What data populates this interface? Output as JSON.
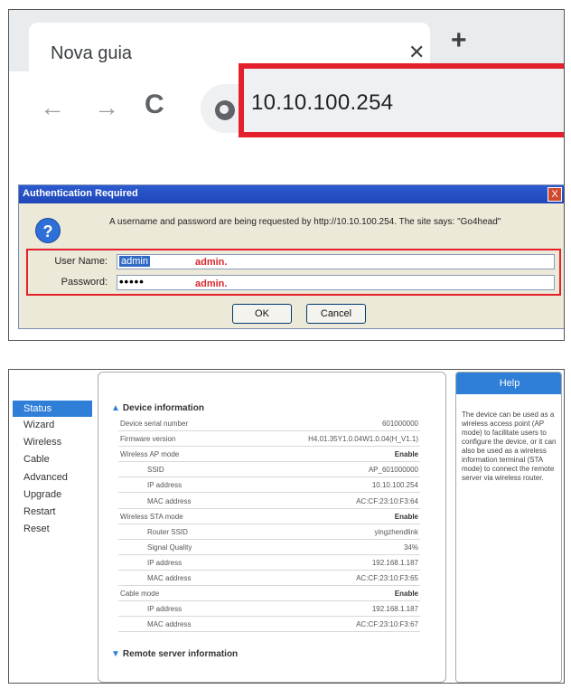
{
  "browser": {
    "tab_title": "Nova guia",
    "close_glyph": "✕",
    "new_tab_glyph": "+",
    "back_glyph": "←",
    "forward_glyph": "→",
    "reload_glyph": "C",
    "url": "10.10.100.254",
    "highlight_color": "#e3202b"
  },
  "auth_dialog": {
    "title": "Authentication Required",
    "close_glyph": "X",
    "help_glyph": "?",
    "message": "A username and password are being requested by http://10.10.100.254. The site says: \"Go4head\"",
    "username_label": "User Name:",
    "username_value": "admin",
    "username_note": "admin.",
    "password_label": "Password:",
    "password_value": "•••••",
    "password_note": "admin.",
    "ok_label": "OK",
    "cancel_label": "Cancel"
  },
  "router": {
    "menu": [
      {
        "label": "Status",
        "active": true
      },
      {
        "label": "Wizard",
        "active": false
      },
      {
        "label": "Wireless",
        "active": false
      },
      {
        "label": "Cable",
        "active": false
      },
      {
        "label": "Advanced",
        "active": false
      },
      {
        "label": "Upgrade",
        "active": false
      },
      {
        "label": "Restart",
        "active": false
      },
      {
        "label": "Reset",
        "active": false
      }
    ],
    "device_info_title": "Device information",
    "rows": [
      {
        "label": "Device serial number",
        "value": "601000000",
        "sub": false,
        "bold": false
      },
      {
        "label": "Firmware version",
        "value": "H4.01.35Y1.0.04W1.0.04(H_V1.1)",
        "sub": false,
        "bold": false
      },
      {
        "label": "Wireless AP mode",
        "value": "Enable",
        "sub": false,
        "bold": true
      },
      {
        "label": "SSID",
        "value": "AP_601000000",
        "sub": true,
        "bold": false
      },
      {
        "label": "IP address",
        "value": "10.10.100.254",
        "sub": true,
        "bold": false
      },
      {
        "label": "MAC address",
        "value": "AC:CF:23:10:F3:64",
        "sub": true,
        "bold": false
      },
      {
        "label": "Wireless STA mode",
        "value": "Enable",
        "sub": false,
        "bold": true
      },
      {
        "label": "Router SSID",
        "value": "yingzhendlink",
        "sub": true,
        "bold": false
      },
      {
        "label": "Signal Quality",
        "value": "34%",
        "sub": true,
        "bold": false
      },
      {
        "label": "IP address",
        "value": "192.168.1.187",
        "sub": true,
        "bold": false
      },
      {
        "label": "MAC address",
        "value": "AC:CF:23:10:F3:65",
        "sub": true,
        "bold": false
      },
      {
        "label": "Cable mode",
        "value": "Enable",
        "sub": false,
        "bold": true
      },
      {
        "label": "IP address",
        "value": "192.168.1.187",
        "sub": true,
        "bold": false
      },
      {
        "label": "MAC address",
        "value": "AC:CF:23:10:F3:67",
        "sub": true,
        "bold": false
      }
    ],
    "remote_title": "Remote server information",
    "help_title": "Help",
    "help_text": "The device can be used as a wireless access point (AP mode) to facilitate users to configure the device, or it can also be used as a wireless information terminal (STA mode) to connect the remote server via wireless router."
  }
}
